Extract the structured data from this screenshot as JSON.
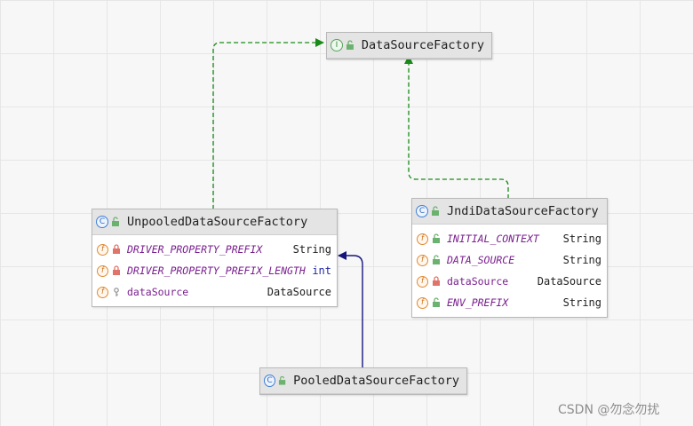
{
  "nodes": {
    "datasource_factory": {
      "kind_icon": "I",
      "kind": "interface",
      "name": "DataSourceFactory"
    },
    "unpooled": {
      "kind_icon": "C",
      "kind": "class",
      "name": "UnpooledDataSourceFactory",
      "fields": [
        {
          "icon": "f",
          "visibility": "private",
          "name": "DRIVER_PROPERTY_PREFIX",
          "type": "String",
          "static": true
        },
        {
          "icon": "f",
          "visibility": "private",
          "name": "DRIVER_PROPERTY_PREFIX_LENGTH",
          "type": "int",
          "static": true
        },
        {
          "icon": "f",
          "visibility": "protected",
          "name": "dataSource",
          "type": "DataSource",
          "static": false
        }
      ]
    },
    "jndi": {
      "kind_icon": "C",
      "kind": "class",
      "name": "JndiDataSourceFactory",
      "fields": [
        {
          "icon": "f",
          "visibility": "public",
          "name": "INITIAL_CONTEXT",
          "type": "String",
          "static": true
        },
        {
          "icon": "f",
          "visibility": "public",
          "name": "DATA_SOURCE",
          "type": "String",
          "static": true
        },
        {
          "icon": "f",
          "visibility": "private",
          "name": "dataSource",
          "type": "DataSource",
          "static": false
        },
        {
          "icon": "f",
          "visibility": "public",
          "name": "ENV_PREFIX",
          "type": "String",
          "static": true
        }
      ]
    },
    "pooled": {
      "kind_icon": "C",
      "kind": "class",
      "name": "PooledDataSourceFactory"
    }
  },
  "edges": [
    {
      "from": "UnpooledDataSourceFactory",
      "to": "DataSourceFactory",
      "relation": "implements",
      "style": "dashed",
      "color": "#1a8a1a"
    },
    {
      "from": "JndiDataSourceFactory",
      "to": "DataSourceFactory",
      "relation": "implements",
      "style": "dashed",
      "color": "#1a8a1a"
    },
    {
      "from": "PooledDataSourceFactory",
      "to": "UnpooledDataSourceFactory",
      "relation": "extends",
      "style": "solid",
      "color": "#16167a"
    }
  ],
  "watermark": "CSDN @勿念勿扰",
  "icons": {
    "interface": "interface-icon",
    "class": "class-icon",
    "field": "field-icon",
    "private": "lock-icon",
    "public": "open-lock-icon",
    "protected": "key-icon"
  }
}
